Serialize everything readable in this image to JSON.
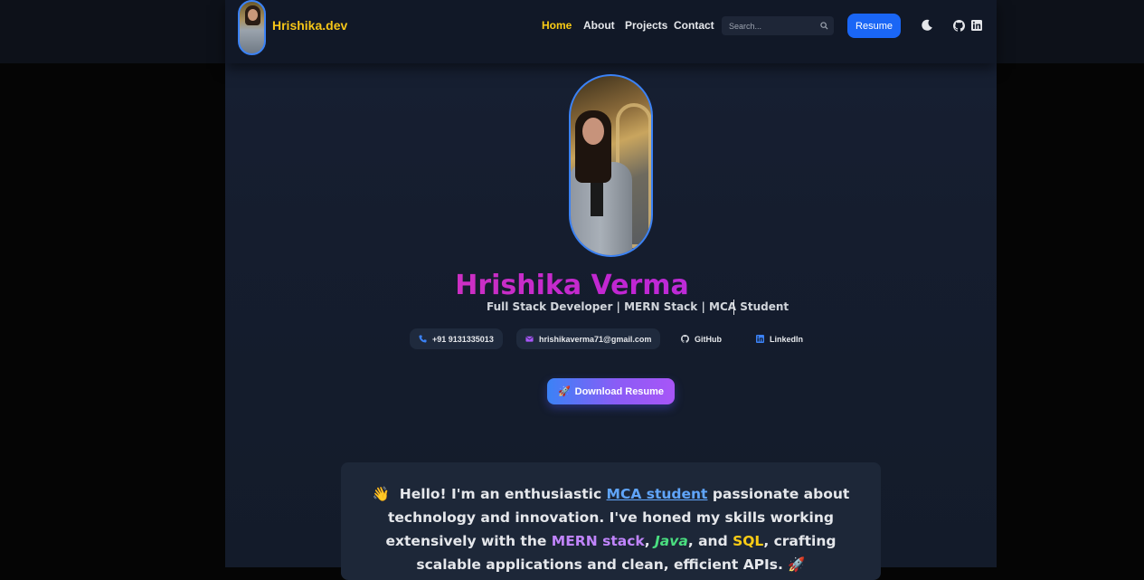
{
  "site": {
    "logo_text": "Hrishika.dev"
  },
  "nav": {
    "links": [
      {
        "label": "Home",
        "active": true
      },
      {
        "label": "About"
      },
      {
        "label": "Projects"
      },
      {
        "label": "Contact"
      }
    ],
    "search_placeholder": "Search...",
    "resume_label": "Resume"
  },
  "icons": {
    "theme_toggle": "moon-icon",
    "github": "github-icon",
    "linkedin": "linkedin-icon",
    "search": "search-icon"
  },
  "hero": {
    "name": "Hrishika Verma",
    "tagline": "Full Stack Developer | MERN Stack | MCA Student",
    "contacts": [
      {
        "label": "+91 9131335013",
        "icon": "phone-icon"
      },
      {
        "label": "hrishikaverma71@gmail.com",
        "icon": "mail-icon"
      },
      {
        "label": "GitHub",
        "icon": "github-icon"
      },
      {
        "label": "LinkedIn",
        "icon": "linkedin-icon"
      }
    ],
    "download_label": "Download Resume",
    "download_emoji": "🚀"
  },
  "about": {
    "wave": "👋",
    "greeting": "Hello! I'm an enthusiastic",
    "link_text": "MCA student",
    "after_link": "passionate about technology and innovation. I've honed my skills working extensively with the",
    "mern": "MERN stack",
    "comma1": ",",
    "java": "Java",
    "and": ", and",
    "sql": "SQL",
    "rest": ", crafting scalable applications and clean, efficient APIs.",
    "rocket": "🚀"
  },
  "colors": {
    "accent": "#facc15",
    "primary_button": "#1a66f5",
    "name_gradient_start": "#ec4899",
    "name_gradient_end": "#a855f7"
  }
}
